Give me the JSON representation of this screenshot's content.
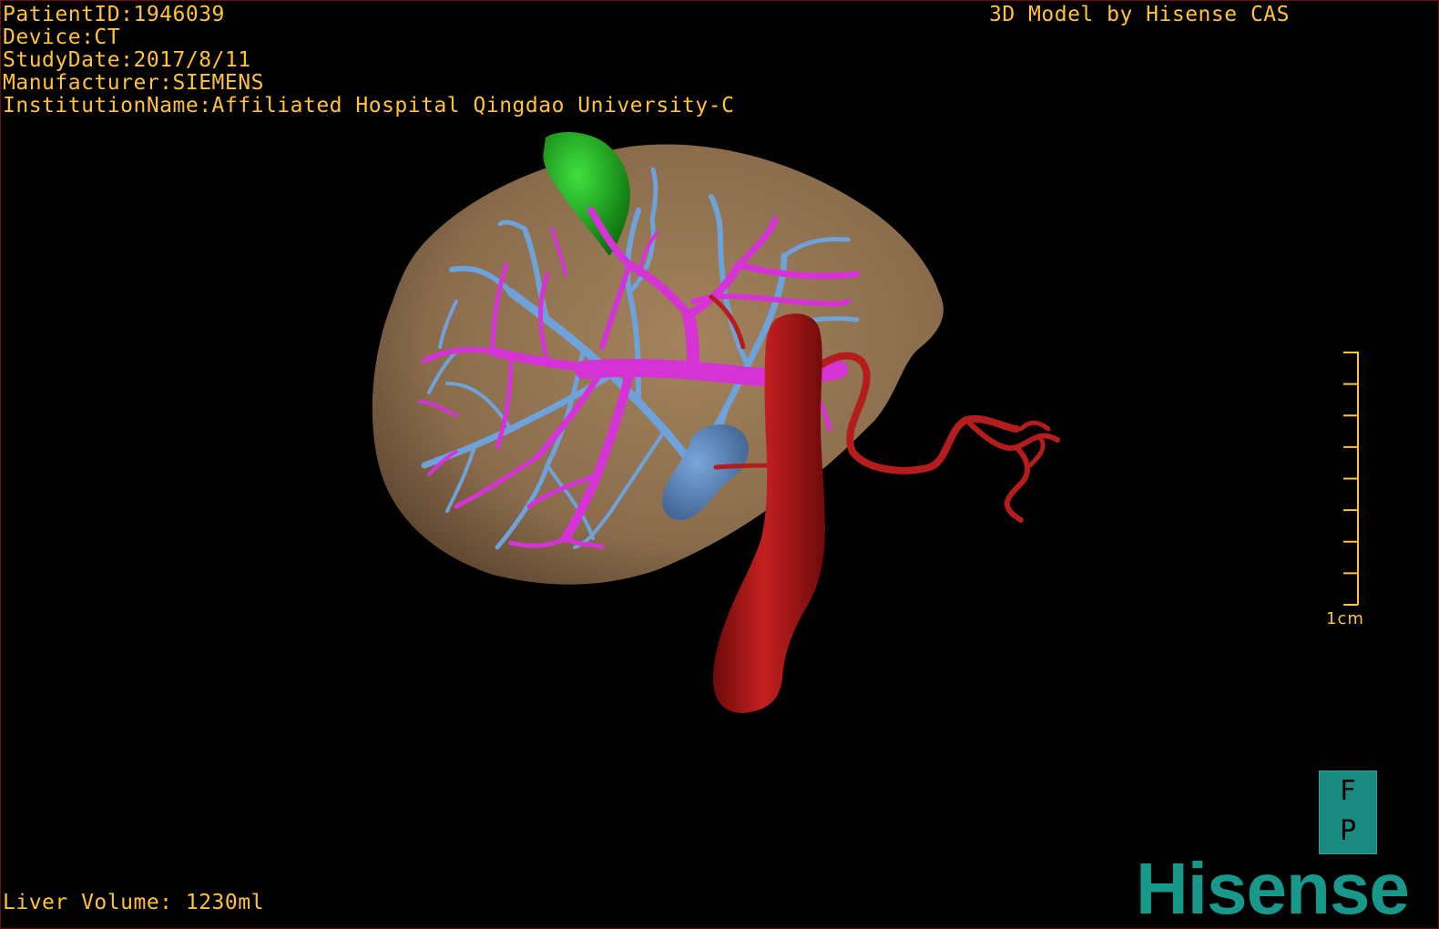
{
  "study_info": {
    "patient_id": "PatientID:1946039",
    "device": "Device:CT",
    "study_date": "StudyDate:2017/8/11",
    "manufacturer": "Manufacturer:SIEMENS",
    "institution": "InstitutionName:Affiliated Hospital Qingdao University-C"
  },
  "model_credit": "3D Model by Hisense CAS",
  "liver_volume": "Liver Volume: 1230ml",
  "scale_bar": {
    "label": "1cm",
    "ticks": 9
  },
  "orientation": {
    "top": "F",
    "bottom": "P"
  },
  "brand": "Hisense",
  "colors": {
    "overlay_text": "#ffc23a",
    "liver": "#8a6e4e",
    "portal_vein": "#d430d4",
    "hepatic_vein": "#6a9fd8",
    "artery": "#b01818",
    "gallbladder": "#1aa01a",
    "brand": "#17988a"
  }
}
